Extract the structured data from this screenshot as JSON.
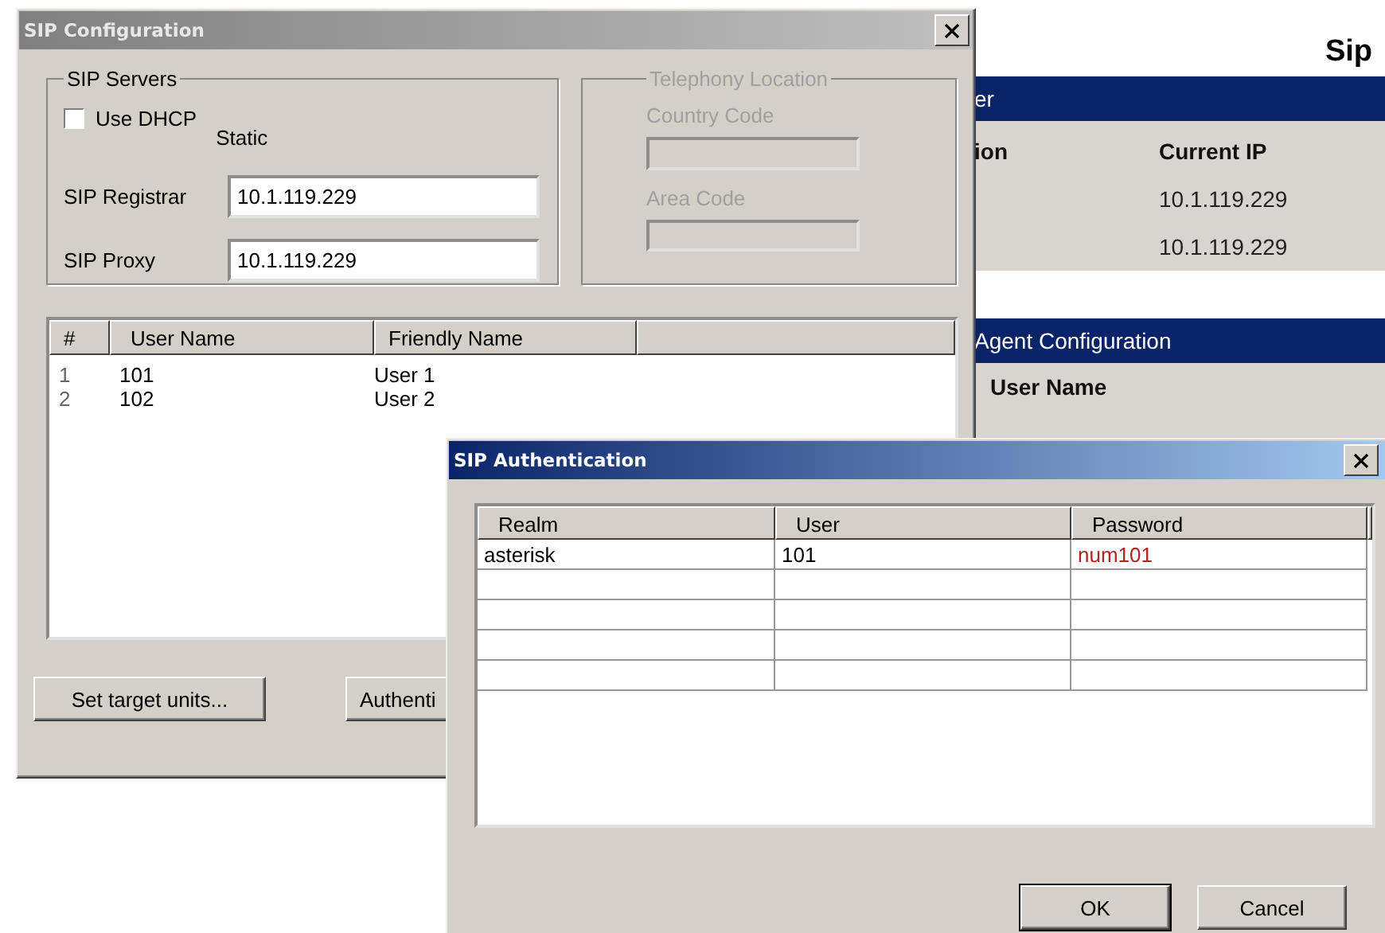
{
  "background_page": {
    "title": "Sip",
    "server_section": {
      "header": "er",
      "columns": [
        "ion",
        "Current IP"
      ],
      "rows": [
        {
          "current_ip": "10.1.119.229"
        },
        {
          "current_ip": "10.1.119.229"
        }
      ]
    },
    "agent_section": {
      "header": "Agent Configuration",
      "columns": [
        "User Name"
      ]
    }
  },
  "sip_configuration": {
    "title": "SIP Configuration",
    "sip_servers": {
      "label": "SIP Servers",
      "use_dhcp": {
        "label": "Use DHCP",
        "checked": false
      },
      "static_label": "Static",
      "registrar": {
        "label": "SIP Registrar",
        "value": "10.1.119.229"
      },
      "proxy": {
        "label": "SIP Proxy",
        "value": "10.1.119.229"
      }
    },
    "telephony_location": {
      "label": "Telephony Location",
      "disabled": true,
      "country_code": {
        "label": "Country Code"
      },
      "area_code": {
        "label": "Area Code"
      }
    },
    "users": {
      "columns": [
        "#",
        "User Name",
        "Friendly Name"
      ],
      "rows": [
        {
          "index": "1",
          "user_name": "101",
          "friendly_name": "User 1"
        },
        {
          "index": "2",
          "user_name": "102",
          "friendly_name": "User 2"
        }
      ]
    },
    "buttons": [
      "Set target units...",
      "Authenti"
    ]
  },
  "sip_authentication": {
    "title": "SIP Authentication",
    "columns": [
      "Realm",
      "User",
      "Password"
    ],
    "rows": [
      {
        "realm": "asterisk",
        "user": "101",
        "password": "num101"
      }
    ],
    "buttons": [
      {
        "label": "OK",
        "default": true
      },
      {
        "label": "Cancel",
        "default": false
      }
    ]
  }
}
